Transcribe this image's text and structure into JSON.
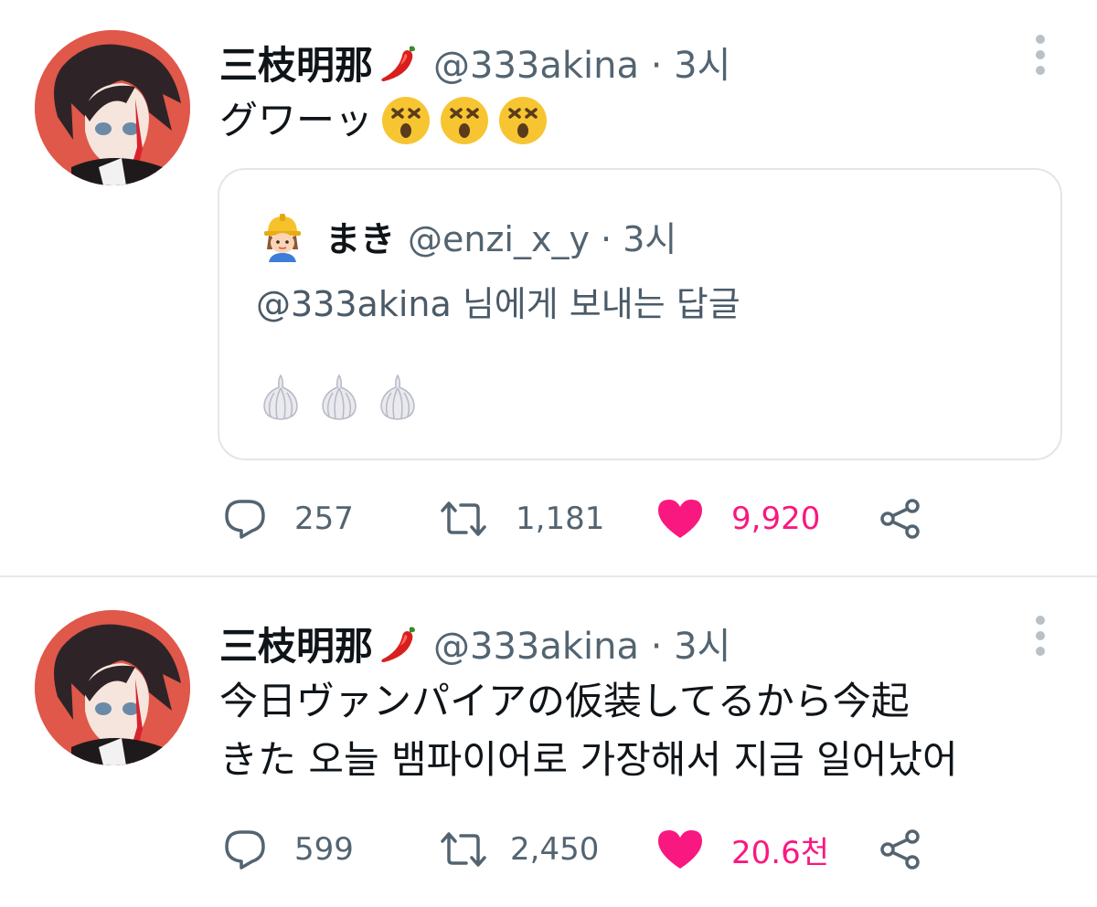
{
  "tweets": [
    {
      "display_name": "三枝明那",
      "name_emoji": "chili-pepper-icon",
      "handle": "@333akina · 3시",
      "text": "グワーッ",
      "text_emojis": [
        "dizzy-face-icon",
        "dizzy-face-icon",
        "dizzy-face-icon"
      ],
      "quote": {
        "avatar": "construction-worker-icon",
        "display_name": "まき",
        "handle": "@enzi_x_y · 3시",
        "reply_to": "@333akina 님에게 보내는 답글",
        "emojis": [
          "garlic-icon",
          "garlic-icon",
          "garlic-icon"
        ]
      },
      "stats": {
        "replies": "257",
        "retweets": "1,181",
        "likes": "9,920"
      },
      "liked": true
    },
    {
      "display_name": "三枝明那",
      "name_emoji": "chili-pepper-icon",
      "handle": "@333akina · 3시",
      "text_line_1": "今日ヴァンパイアの仮装してるから今起",
      "text_line_2": "きた 오늘 뱀파이어로 가장해서 지금 일어났어",
      "stats": {
        "replies": "599",
        "retweets": "2,450",
        "likes": "20.6천"
      },
      "liked": true
    }
  ],
  "colors": {
    "like": "#f91880",
    "secondary_text": "#536471",
    "avatar_background": "#e0584a",
    "divider": "#e6e9eb"
  }
}
